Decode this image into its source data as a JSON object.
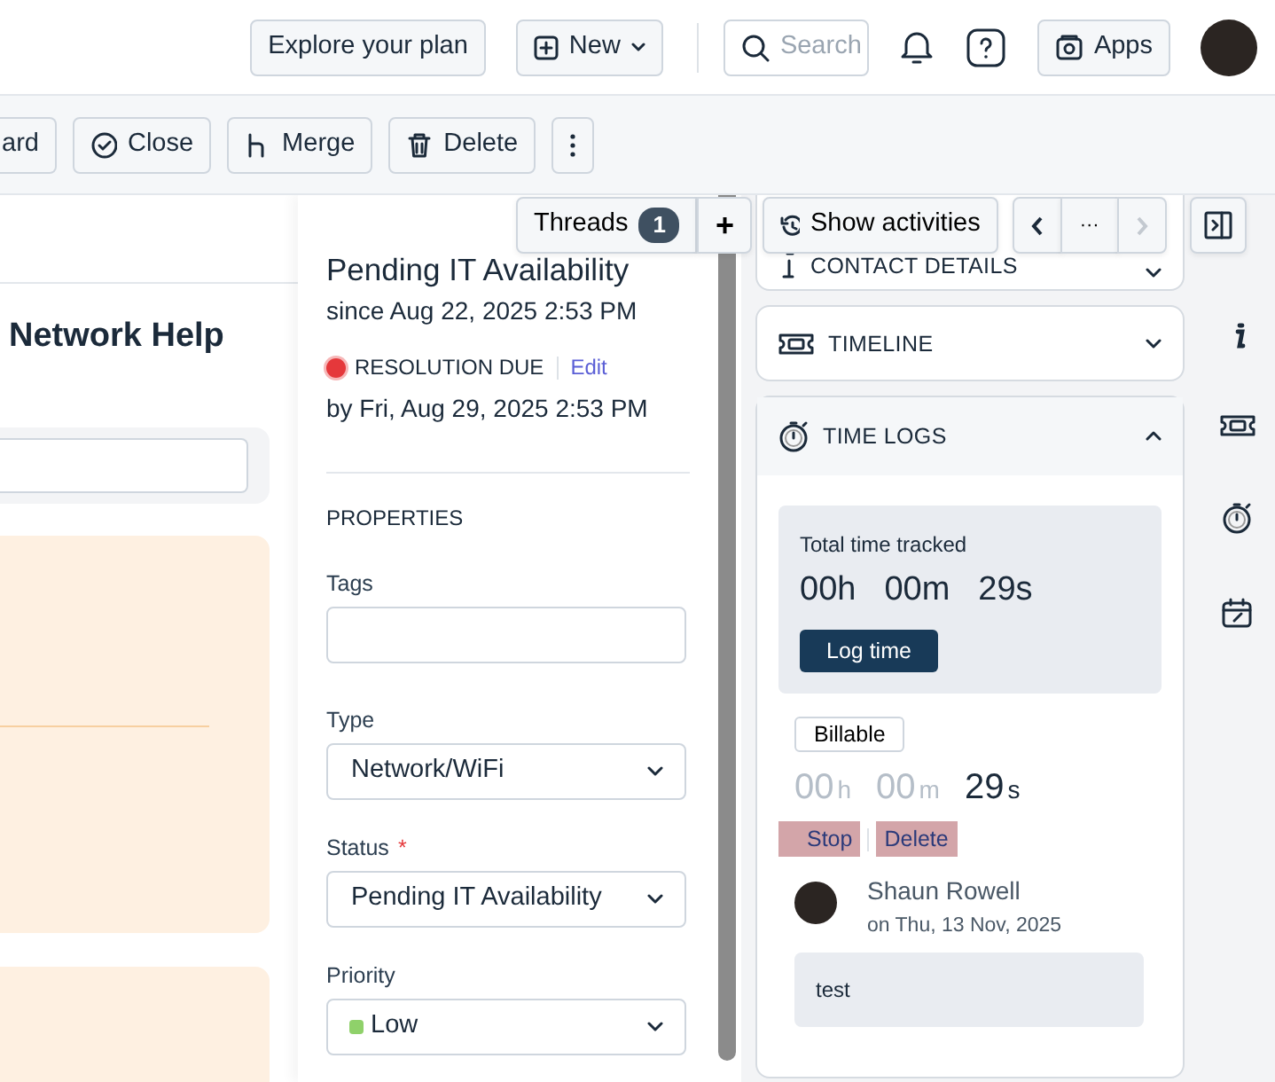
{
  "topbar": {
    "explore": "Explore your plan",
    "new": "New",
    "search_placeholder": "Search",
    "apps": "Apps"
  },
  "toolbar": [
    {
      "kind": "text",
      "label": "ard"
    },
    {
      "kind": "close",
      "label": "Close"
    },
    {
      "kind": "merge",
      "label": "Merge"
    },
    {
      "kind": "delete",
      "label": "Delete"
    },
    {
      "kind": "more"
    }
  ],
  "ticket": {
    "heading": "Network Help"
  },
  "status": {
    "title": "Pending IT Availability",
    "since": "since Aug 22, 2025 2:53 PM",
    "sla_label": "RESOLUTION DUE",
    "sla_link": "Edit",
    "due": "by Fri, Aug 29, 2025 2:53 PM"
  },
  "properties": {
    "heading": "PROPERTIES",
    "fields": [
      {
        "kind": "text",
        "label": "Tags"
      },
      {
        "kind": "select",
        "label": "Type",
        "value": "Network/WiFi"
      },
      {
        "kind": "select",
        "label": "Status",
        "required_mark": "*",
        "value": "Pending IT Availability"
      },
      {
        "kind": "select",
        "label": "Priority",
        "value": "Low",
        "color": "#8fd16a"
      }
    ]
  },
  "threads_bar": {
    "label": "Threads",
    "count": "1",
    "add": "+",
    "activities": "Show activities",
    "more": "···"
  },
  "panels": [
    {
      "kind": "contact",
      "title": "CONTACT DETAILS",
      "expanded": false
    },
    {
      "kind": "ticket",
      "title": "TIMELINE",
      "expanded": false
    },
    {
      "kind": "stopwatch",
      "title": "TIME LOGS",
      "expanded": true
    }
  ],
  "time_logs": {
    "total_label": "Total time tracked",
    "total": [
      "00h",
      "00m",
      "29s"
    ],
    "log_button": "Log time",
    "billable": "Billable",
    "timer": [
      {
        "value": "00",
        "unit": "h",
        "active": false
      },
      {
        "value": "00",
        "unit": "m",
        "active": false
      },
      {
        "value": "29",
        "unit": "s",
        "active": true
      }
    ],
    "actions": [
      "Stop",
      "Delete"
    ],
    "entry": {
      "author": "Shaun Rowell",
      "date": "on Thu, 13 Nov, 2025",
      "note": "test"
    }
  }
}
